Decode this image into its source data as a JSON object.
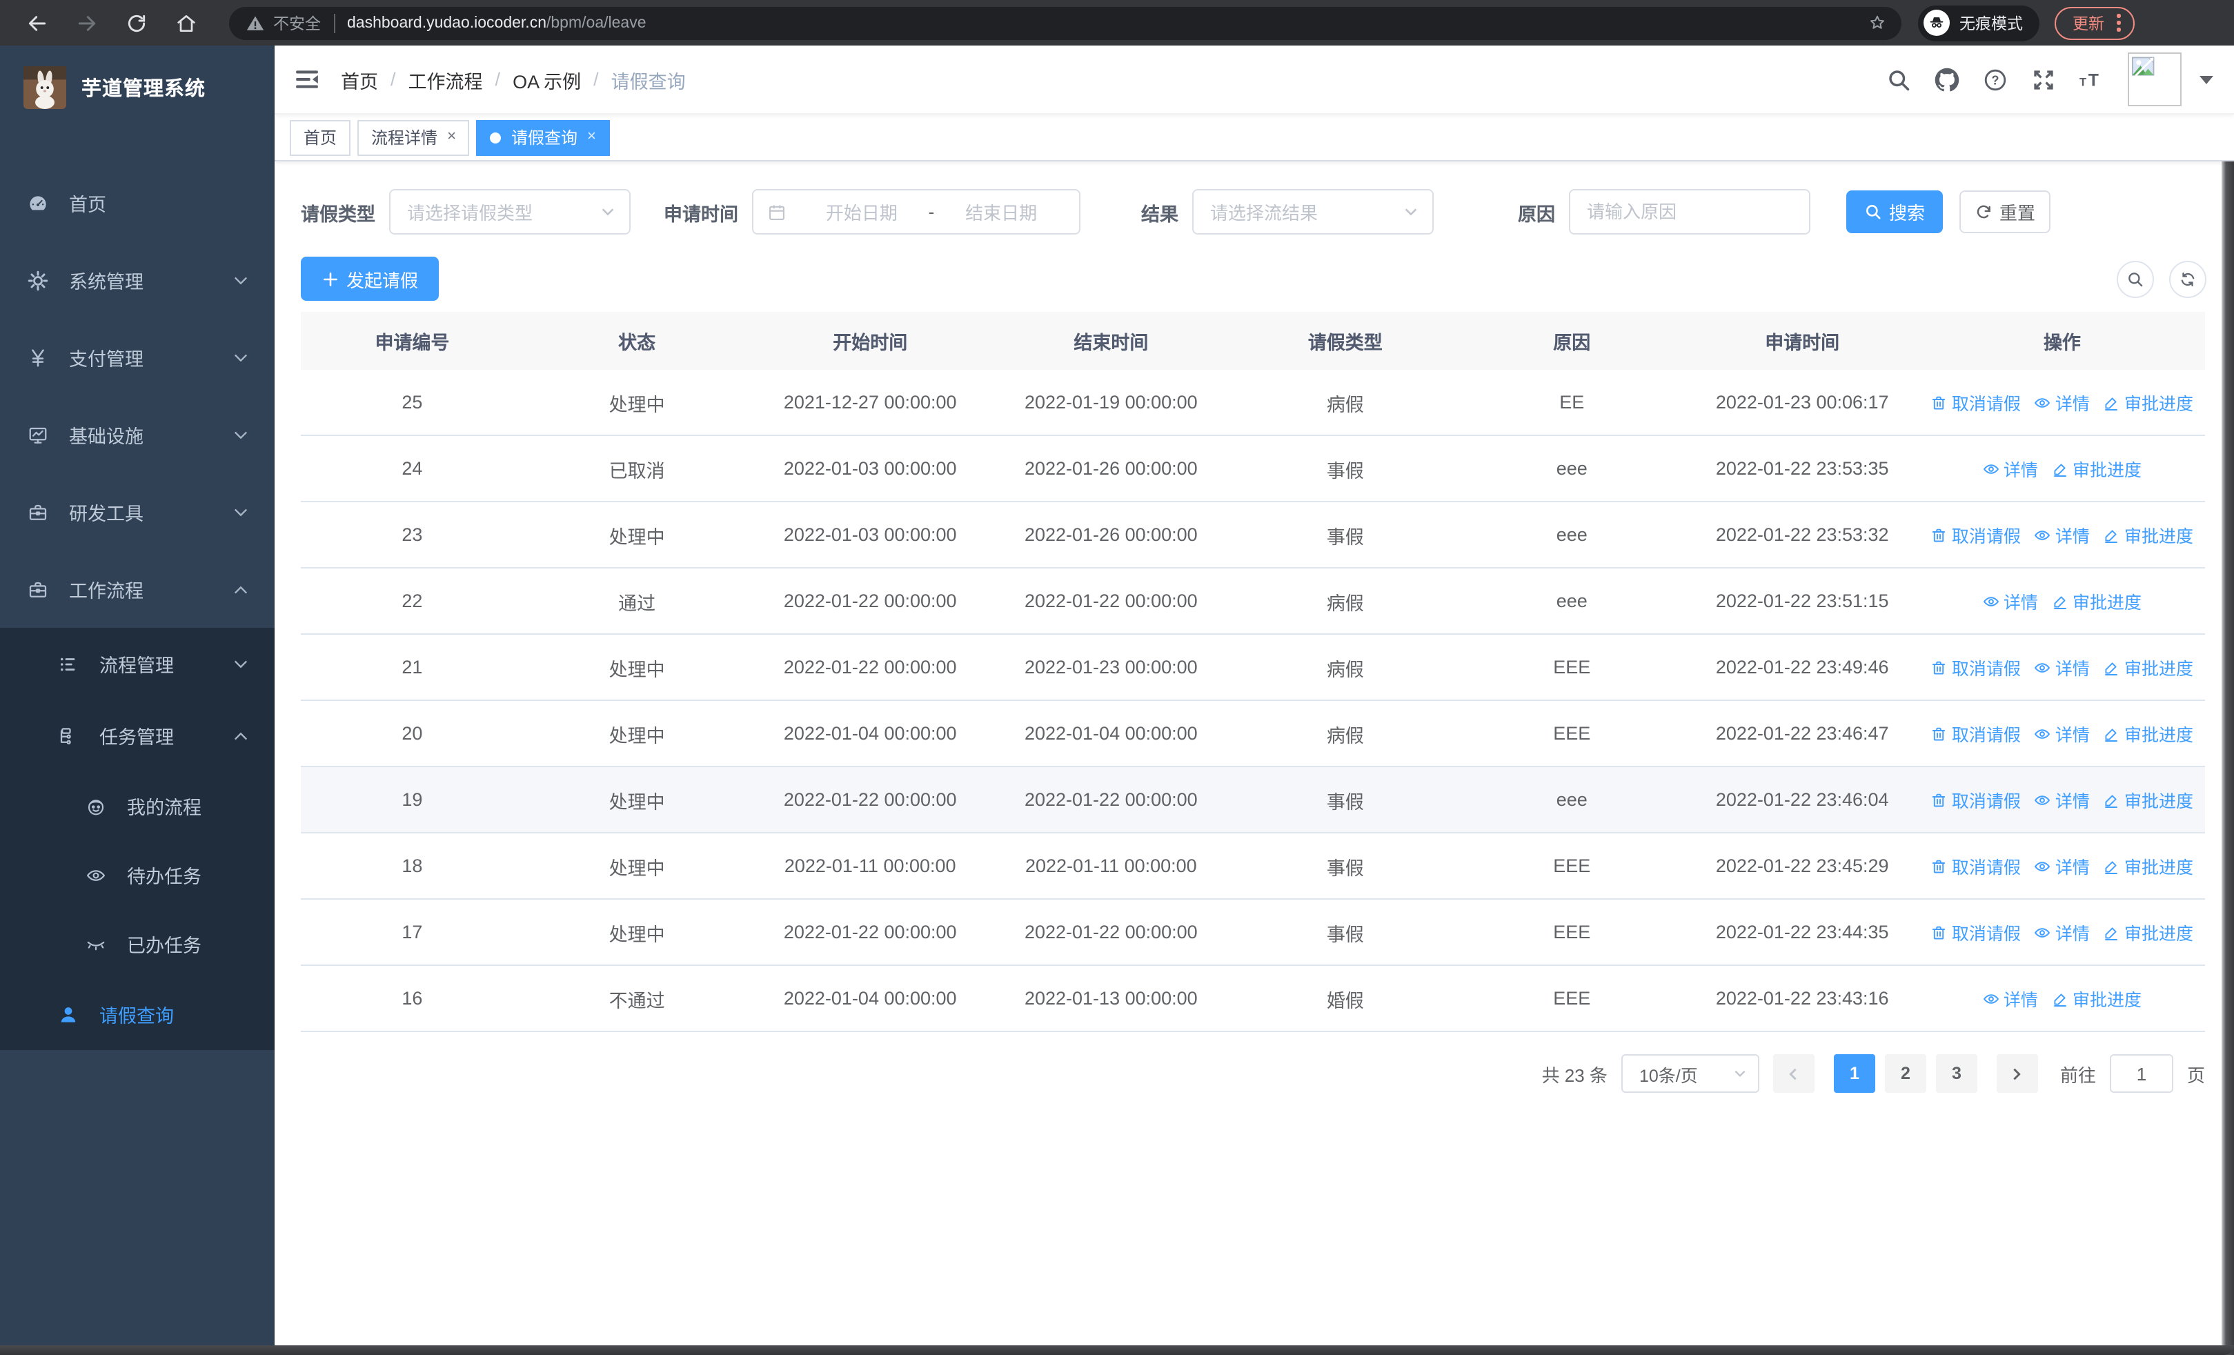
{
  "colors": {
    "primary": "#409eff",
    "sidebar_bg": "#304156",
    "submenu_bg": "#1f2d3d",
    "update_accent": "#f28b82",
    "link_blue": "#409eff"
  },
  "browser": {
    "security_label": "不安全",
    "url_host": "dashboard.yudao.iocoder.cn",
    "url_path": "/bpm/oa/leave",
    "incognito_label": "无痕模式",
    "update_label": "更新"
  },
  "sidebar": {
    "logo_title": "芋道管理系统",
    "items": [
      {
        "label": "首页",
        "icon": "dashboard-icon",
        "depth": 0
      },
      {
        "label": "系统管理",
        "icon": "gear-icon",
        "depth": 0,
        "arrow": "down"
      },
      {
        "label": "支付管理",
        "icon": "yen-icon",
        "depth": 0,
        "arrow": "down"
      },
      {
        "label": "基础设施",
        "icon": "monitor-icon",
        "depth": 0,
        "arrow": "down"
      },
      {
        "label": "研发工具",
        "icon": "toolbox-icon",
        "depth": 0,
        "arrow": "down"
      },
      {
        "label": "工作流程",
        "icon": "briefcase-icon",
        "depth": 0,
        "arrow": "up"
      },
      {
        "label": "流程管理",
        "icon": "list-icon",
        "depth": 1,
        "sub": true,
        "arrow": "down"
      },
      {
        "label": "任务管理",
        "icon": "tree-icon",
        "depth": 1,
        "sub": true,
        "arrow": "up"
      },
      {
        "label": "我的流程",
        "icon": "face-icon",
        "depth": 2,
        "sub": true
      },
      {
        "label": "待办任务",
        "icon": "eye-open-icon",
        "depth": 2,
        "sub": true
      },
      {
        "label": "已办任务",
        "icon": "eye-closed-icon",
        "depth": 2,
        "sub": true
      },
      {
        "label": "请假查询",
        "icon": "user-icon",
        "depth": 1,
        "sub": true,
        "active": true
      }
    ]
  },
  "header": {
    "breadcrumbs": [
      "首页",
      "工作流程",
      "OA 示例",
      "请假查询"
    ],
    "breadcrumb_separator": "/"
  },
  "tabs": [
    {
      "label": "首页",
      "active": false,
      "closable": false
    },
    {
      "label": "流程详情",
      "active": false,
      "closable": true
    },
    {
      "label": "请假查询",
      "active": true,
      "closable": true
    }
  ],
  "filters": {
    "leave_type": {
      "label": "请假类型",
      "placeholder": "请选择请假类型"
    },
    "apply_time": {
      "label": "申请时间",
      "start_placeholder": "开始日期",
      "separator": "-",
      "end_placeholder": "结束日期"
    },
    "result": {
      "label": "结果",
      "placeholder": "请选择流结果"
    },
    "reason": {
      "label": "原因",
      "placeholder": "请输入原因"
    },
    "search_label": "搜索",
    "reset_label": "重置"
  },
  "toolbar": {
    "create_label": "发起请假"
  },
  "table": {
    "columns": [
      "申请编号",
      "状态",
      "开始时间",
      "结束时间",
      "请假类型",
      "原因",
      "申请时间",
      "操作"
    ],
    "action_labels": {
      "cancel": "取消请假",
      "detail": "详情",
      "progress": "审批进度"
    },
    "rows": [
      {
        "id": "25",
        "status": "处理中",
        "start": "2021-12-27 00:00:00",
        "end": "2022-01-19 00:00:00",
        "type": "病假",
        "reason": "EE",
        "applied": "2022-01-23 00:06:17",
        "actions": [
          "cancel",
          "detail",
          "progress"
        ],
        "highlight": false
      },
      {
        "id": "24",
        "status": "已取消",
        "start": "2022-01-03 00:00:00",
        "end": "2022-01-26 00:00:00",
        "type": "事假",
        "reason": "eee",
        "applied": "2022-01-22 23:53:35",
        "actions": [
          "detail",
          "progress"
        ],
        "highlight": false
      },
      {
        "id": "23",
        "status": "处理中",
        "start": "2022-01-03 00:00:00",
        "end": "2022-01-26 00:00:00",
        "type": "事假",
        "reason": "eee",
        "applied": "2022-01-22 23:53:32",
        "actions": [
          "cancel",
          "detail",
          "progress"
        ],
        "highlight": false
      },
      {
        "id": "22",
        "status": "通过",
        "start": "2022-01-22 00:00:00",
        "end": "2022-01-22 00:00:00",
        "type": "病假",
        "reason": "eee",
        "applied": "2022-01-22 23:51:15",
        "actions": [
          "detail",
          "progress"
        ],
        "highlight": false
      },
      {
        "id": "21",
        "status": "处理中",
        "start": "2022-01-22 00:00:00",
        "end": "2022-01-23 00:00:00",
        "type": "病假",
        "reason": "EEE",
        "applied": "2022-01-22 23:49:46",
        "actions": [
          "cancel",
          "detail",
          "progress"
        ],
        "highlight": false
      },
      {
        "id": "20",
        "status": "处理中",
        "start": "2022-01-04 00:00:00",
        "end": "2022-01-04 00:00:00",
        "type": "病假",
        "reason": "EEE",
        "applied": "2022-01-22 23:46:47",
        "actions": [
          "cancel",
          "detail",
          "progress"
        ],
        "highlight": false
      },
      {
        "id": "19",
        "status": "处理中",
        "start": "2022-01-22 00:00:00",
        "end": "2022-01-22 00:00:00",
        "type": "事假",
        "reason": "eee",
        "applied": "2022-01-22 23:46:04",
        "actions": [
          "cancel",
          "detail",
          "progress"
        ],
        "highlight": true
      },
      {
        "id": "18",
        "status": "处理中",
        "start": "2022-01-11 00:00:00",
        "end": "2022-01-11 00:00:00",
        "type": "事假",
        "reason": "EEE",
        "applied": "2022-01-22 23:45:29",
        "actions": [
          "cancel",
          "detail",
          "progress"
        ],
        "highlight": false
      },
      {
        "id": "17",
        "status": "处理中",
        "start": "2022-01-22 00:00:00",
        "end": "2022-01-22 00:00:00",
        "type": "事假",
        "reason": "EEE",
        "applied": "2022-01-22 23:44:35",
        "actions": [
          "cancel",
          "detail",
          "progress"
        ],
        "highlight": false
      },
      {
        "id": "16",
        "status": "不通过",
        "start": "2022-01-04 00:00:00",
        "end": "2022-01-13 00:00:00",
        "type": "婚假",
        "reason": "EEE",
        "applied": "2022-01-22 23:43:16",
        "actions": [
          "detail",
          "progress"
        ],
        "highlight": false
      }
    ]
  },
  "pagination": {
    "total_label": "共 23 条",
    "page_size": "10条/页",
    "pages": [
      "1",
      "2",
      "3"
    ],
    "active_page": "1",
    "goto_label": "前往",
    "goto_value": "1",
    "page_label": "页"
  }
}
